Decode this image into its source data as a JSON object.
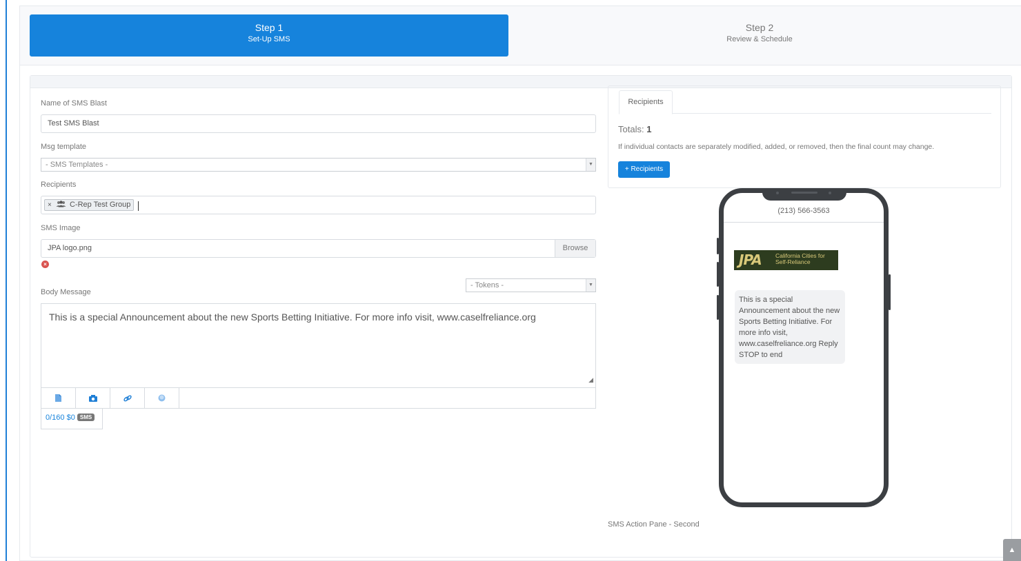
{
  "steps": [
    {
      "title": "Step 1",
      "subtitle": "Set-Up SMS",
      "active": true
    },
    {
      "title": "Step 2",
      "subtitle": "Review & Schedule",
      "active": false
    }
  ],
  "form": {
    "name_label": "Name of SMS Blast",
    "name_value": "Test SMS Blast",
    "template_label": "Msg template",
    "template_value": "- SMS Templates -",
    "recipients_label": "Recipients",
    "recipient_tag": "C-Rep Test Group",
    "recipient_tag_remove": "×",
    "image_label": "SMS Image",
    "image_value": "JPA logo.png",
    "browse_label": "Browse",
    "tokens_value": "- Tokens -",
    "body_label": "Body Message",
    "body_value": "This is a special Announcement about the new Sports Betting Initiative. For more info visit, www.caselfreliance.org",
    "counter": "0/160 $0",
    "counter_badge": "SMS"
  },
  "recipients_panel": {
    "tab_label": "Recipients",
    "totals_label": "Totals:",
    "totals_value": "1",
    "note": "If individual contacts are separately modified, added, or removed, then the final count may change.",
    "button_label": "+ Recipients"
  },
  "phone": {
    "number": "(213) 566-3563",
    "logo_mark": "JPA",
    "logo_text": "California Cities for Self-Reliance",
    "message": "This is a special Announcement about the new Sports Betting Initiative. For more info visit, www.caselfreliance.org Reply STOP to end"
  },
  "footer_note": "SMS Action Pane - Second",
  "icons": [
    "user-group-icon",
    "document-icon",
    "camera-icon",
    "link-icon",
    "emoji-icon",
    "remove-icon",
    "resize-grip-icon",
    "chevron-up-icon"
  ],
  "colors": {
    "primary": "#1683dc",
    "danger": "#d9534f",
    "phone_frame": "#3c3f43",
    "logo_bg": "#2d3c1f"
  }
}
